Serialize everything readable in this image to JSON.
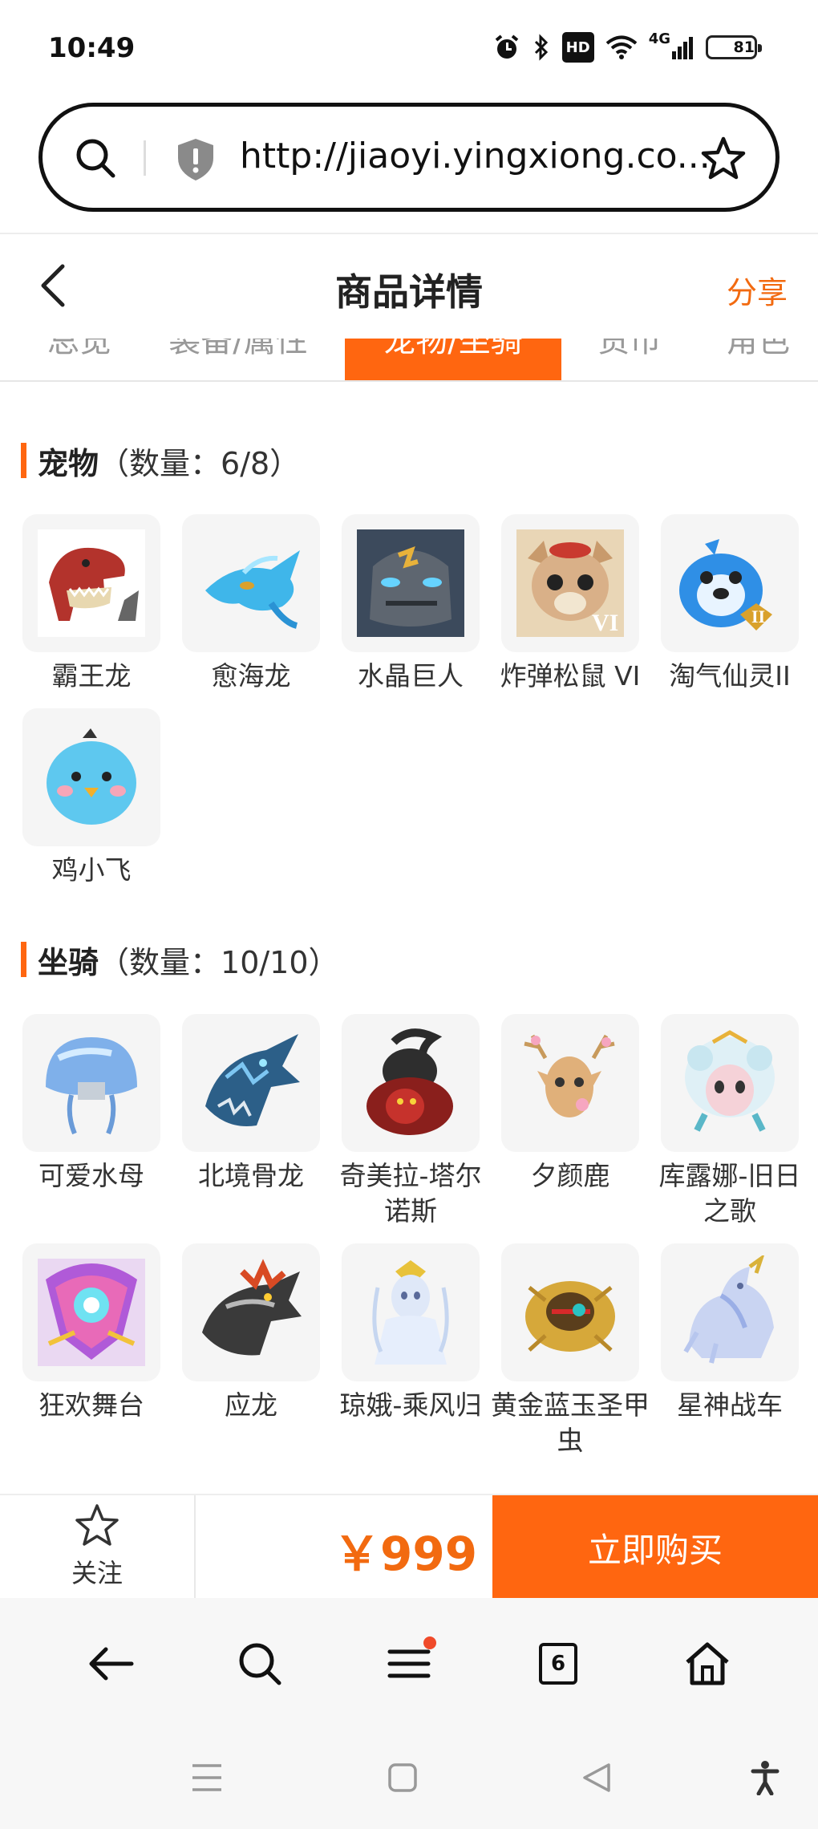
{
  "status_bar": {
    "time": "10:49",
    "hd": "HD",
    "network": "4G",
    "battery": "81",
    "battery_level_pct": 81
  },
  "address_bar": {
    "url": "http://jiaoyi.yingxiong.co..."
  },
  "header": {
    "title": "商品详情",
    "share": "分享"
  },
  "tabs": [
    {
      "label": "总览"
    },
    {
      "label": "装备/属性"
    },
    {
      "label": "宠物/坐骑"
    },
    {
      "label": "货币"
    },
    {
      "label": "角色"
    }
  ],
  "pets_section": {
    "name": "宠物",
    "count": "（数量：6/8）",
    "items": [
      {
        "name": "霸王龙"
      },
      {
        "name": "愈海龙"
      },
      {
        "name": "水晶巨人"
      },
      {
        "name": "炸弹松鼠 VI"
      },
      {
        "name": "淘气仙灵II"
      },
      {
        "name": "鸡小飞"
      }
    ]
  },
  "mounts_section": {
    "name": "坐骑",
    "count": "（数量：10/10）",
    "items": [
      {
        "name": "可爱水母"
      },
      {
        "name": "北境骨龙"
      },
      {
        "name": "奇美拉-塔尔诺斯"
      },
      {
        "name": "夕颜鹿"
      },
      {
        "name": "库露娜-旧日之歌"
      },
      {
        "name": "狂欢舞台"
      },
      {
        "name": "应龙"
      },
      {
        "name": "琼娥-乘风归"
      },
      {
        "name": "黄金蓝玉圣甲虫"
      },
      {
        "name": "星神战车"
      }
    ]
  },
  "buy_bar": {
    "follow": "关注",
    "price": "￥999",
    "buy": "立即购买"
  },
  "toolbar": {
    "tab_count": "6"
  },
  "colors": {
    "accent": "#ff6610",
    "price": "#f26a10"
  }
}
